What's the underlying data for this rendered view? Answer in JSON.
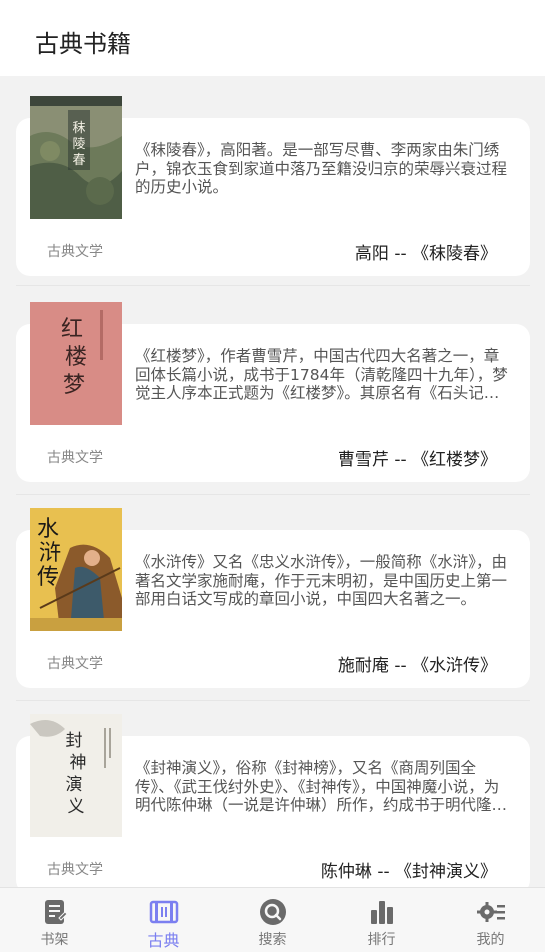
{
  "header": {
    "title": "古典书籍"
  },
  "books": [
    {
      "title": "秣陵春",
      "description": "《秣陵春》，高阳著。是一部写尽曹、李两家由朱门绣户，锦衣玉食到家道中落乃至籍没归京的荣辱兴衰过程的历史小说。",
      "category": "古典文学",
      "author_line": "高阳 -- 《秣陵春》",
      "cover_text": "秣陵春"
    },
    {
      "title": "红楼梦",
      "description": "《红楼梦》，作者曹雪芹，中国古代四大名著之一，章回体长篇小说，成书于1784年（清乾隆四十九年），梦觉主人序本正式题为《红楼梦》。其原名有《石头记》等。",
      "category": "古典文学",
      "author_line": "曹雪芹 -- 《红楼梦》",
      "cover_text": "红楼梦"
    },
    {
      "title": "水浒传",
      "description": "《水浒传》又名《忠义水浒传》，一般简称《水浒》，由著名文学家施耐庵，作于元末明初，是中国历史上第一部用白话文写成的章回小说，中国四大名著之一。",
      "category": "古典文学",
      "author_line": "施耐庵 -- 《水浒传》",
      "cover_text": "水浒传"
    },
    {
      "title": "封神演义",
      "description": "《封神演义》，俗称《封神榜》，又名《商周列国全传》、《武王伐纣外史》、《封神传》，中国神魔小说，为明代陈仲琳（一说是许仲琳）所作，约成书于明代隆庆、万历年间。",
      "category": "古典文学",
      "author_line": "陈仲琳 -- 《封神演义》",
      "cover_text": "封神演义"
    }
  ],
  "tabs": [
    {
      "label": "书架",
      "icon": "book-edit-icon",
      "active": false
    },
    {
      "label": "古典",
      "icon": "scroll-icon",
      "active": true
    },
    {
      "label": "搜索",
      "icon": "search-icon",
      "active": false
    },
    {
      "label": "排行",
      "icon": "bar-chart-icon",
      "active": false
    },
    {
      "label": "我的",
      "icon": "settings-list-icon",
      "active": false
    }
  ],
  "colors": {
    "accent": "#7b7ff0",
    "tab_inactive": "#777777",
    "card_bg": "#ffffff",
    "page_bg": "#f2f2f2"
  }
}
